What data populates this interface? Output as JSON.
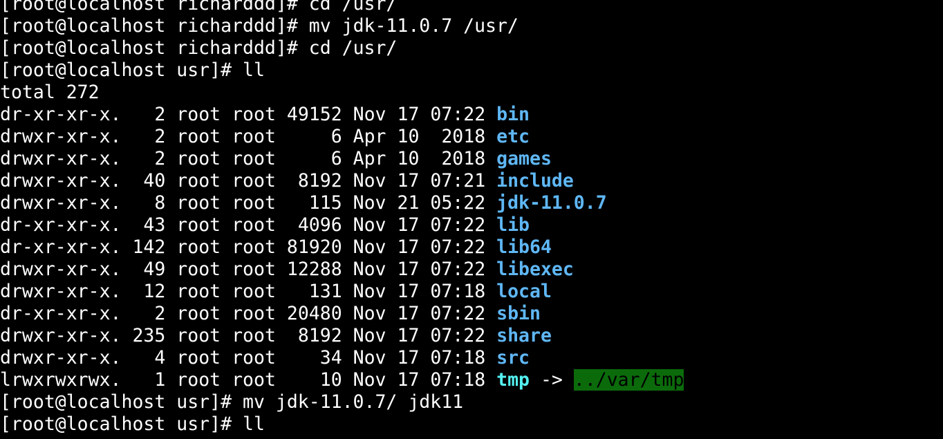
{
  "theme": {
    "background": "#000000",
    "foreground": "#ffffff",
    "directory_color": "#5fb7f5",
    "symlink_color": "#54f1f1",
    "symlink_target_bg": "#0b6b0b"
  },
  "cut_top_line": "[root@localhost richarddd]# cd /usr/",
  "commands": [
    {
      "prompt": "[root@localhost richarddd]#",
      "command": "mv jdk-11.0.7 /usr/"
    },
    {
      "prompt": "[root@localhost richarddd]#",
      "command": "cd /usr/"
    },
    {
      "prompt": "[root@localhost usr]#",
      "command": "ll"
    }
  ],
  "total_line": "total 272",
  "listing": [
    {
      "mode": "dr-xr-xr-x.",
      "links": "2",
      "owner": "root",
      "group": "root",
      "size": "49152",
      "month": "Nov",
      "day": "17",
      "time": "07:22",
      "name": "bin"
    },
    {
      "mode": "drwxr-xr-x.",
      "links": "2",
      "owner": "root",
      "group": "root",
      "size": "6",
      "month": "Apr",
      "day": "10",
      "time": "2018",
      "name": "etc"
    },
    {
      "mode": "drwxr-xr-x.",
      "links": "2",
      "owner": "root",
      "group": "root",
      "size": "6",
      "month": "Apr",
      "day": "10",
      "time": "2018",
      "name": "games"
    },
    {
      "mode": "drwxr-xr-x.",
      "links": "40",
      "owner": "root",
      "group": "root",
      "size": "8192",
      "month": "Nov",
      "day": "17",
      "time": "07:21",
      "name": "include"
    },
    {
      "mode": "drwxr-xr-x.",
      "links": "8",
      "owner": "root",
      "group": "root",
      "size": "115",
      "month": "Nov",
      "day": "21",
      "time": "05:22",
      "name": "jdk-11.0.7"
    },
    {
      "mode": "dr-xr-xr-x.",
      "links": "43",
      "owner": "root",
      "group": "root",
      "size": "4096",
      "month": "Nov",
      "day": "17",
      "time": "07:22",
      "name": "lib"
    },
    {
      "mode": "dr-xr-xr-x.",
      "links": "142",
      "owner": "root",
      "group": "root",
      "size": "81920",
      "month": "Nov",
      "day": "17",
      "time": "07:22",
      "name": "lib64"
    },
    {
      "mode": "drwxr-xr-x.",
      "links": "49",
      "owner": "root",
      "group": "root",
      "size": "12288",
      "month": "Nov",
      "day": "17",
      "time": "07:22",
      "name": "libexec"
    },
    {
      "mode": "drwxr-xr-x.",
      "links": "12",
      "owner": "root",
      "group": "root",
      "size": "131",
      "month": "Nov",
      "day": "17",
      "time": "07:18",
      "name": "local"
    },
    {
      "mode": "dr-xr-xr-x.",
      "links": "2",
      "owner": "root",
      "group": "root",
      "size": "20480",
      "month": "Nov",
      "day": "17",
      "time": "07:22",
      "name": "sbin"
    },
    {
      "mode": "drwxr-xr-x.",
      "links": "235",
      "owner": "root",
      "group": "root",
      "size": "8192",
      "month": "Nov",
      "day": "17",
      "time": "07:22",
      "name": "share"
    },
    {
      "mode": "drwxr-xr-x.",
      "links": "4",
      "owner": "root",
      "group": "root",
      "size": "34",
      "month": "Nov",
      "day": "17",
      "time": "07:18",
      "name": "src"
    }
  ],
  "symlink_entry": {
    "mode": "lrwxrwxrwx.",
    "links": "1",
    "owner": "root",
    "group": "root",
    "size": "10",
    "month": "Nov",
    "day": "17",
    "time": "07:18",
    "name": "tmp",
    "arrow": "->",
    "target": "../var/tmp"
  },
  "after_commands": [
    {
      "prompt": "[root@localhost usr]#",
      "command": "mv jdk-11.0.7/ jdk11"
    },
    {
      "prompt": "[root@localhost usr]#",
      "command": "ll"
    }
  ]
}
